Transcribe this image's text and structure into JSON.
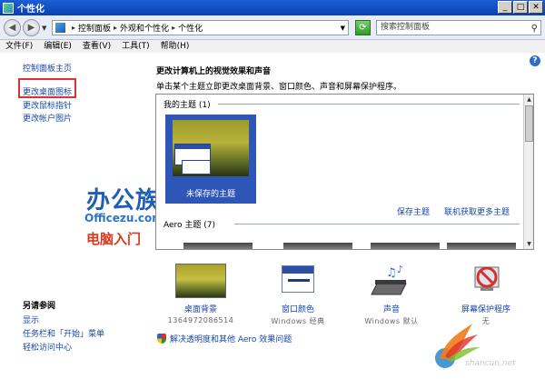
{
  "window": {
    "title": "个性化"
  },
  "nav": {
    "back": "◀",
    "forward": "▶"
  },
  "address": {
    "crumbs": [
      "控制面板",
      "外观和个性化",
      "个性化"
    ],
    "separator": "▸"
  },
  "search": {
    "placeholder": "搜索控制面板"
  },
  "menu": [
    "文件(F)",
    "编辑(E)",
    "查看(V)",
    "工具(T)",
    "帮助(H)"
  ],
  "sidebar": {
    "home": "控制面板主页",
    "links": [
      "更改桌面图标",
      "更改鼠标指针",
      "更改帐户图片"
    ],
    "see_also_title": "另请参阅",
    "see_also": [
      "显示",
      "任务栏和「开始」菜单",
      "轻松访问中心"
    ]
  },
  "watermark": {
    "brand_cn": "办公族",
    "brand_en": "Officezu.com",
    "slogan": "电脑入门"
  },
  "main": {
    "title": "更改计算机上的视觉效果和声音",
    "description": "单击某个主题立即更改桌面背景、窗口颜色、声音和屏幕保护程序。",
    "my_themes": "我的主题 (1)",
    "aero_themes": "Aero 主题 (7)",
    "unsaved_theme": "未保存的主题",
    "save_theme": "保存主题",
    "get_more": "联机获取更多主题"
  },
  "options": [
    {
      "label": "桌面背景",
      "sub": "1364972086514",
      "icon": "desktop-background-icon"
    },
    {
      "label": "窗口颜色",
      "sub": "Windows 经典",
      "icon": "window-color-icon"
    },
    {
      "label": "声音",
      "sub": "Windows 默认",
      "icon": "sound-icon"
    },
    {
      "label": "屏幕保护程序",
      "sub": "无",
      "icon": "screensaver-icon"
    }
  ],
  "troubleshoot": "解决透明度和其他 Aero 效果问题",
  "corner_watermark": "shancun.net",
  "colors": {
    "link": "#1747a6",
    "highlight_box": "#e03030",
    "titlebar": "#0a40b0"
  }
}
